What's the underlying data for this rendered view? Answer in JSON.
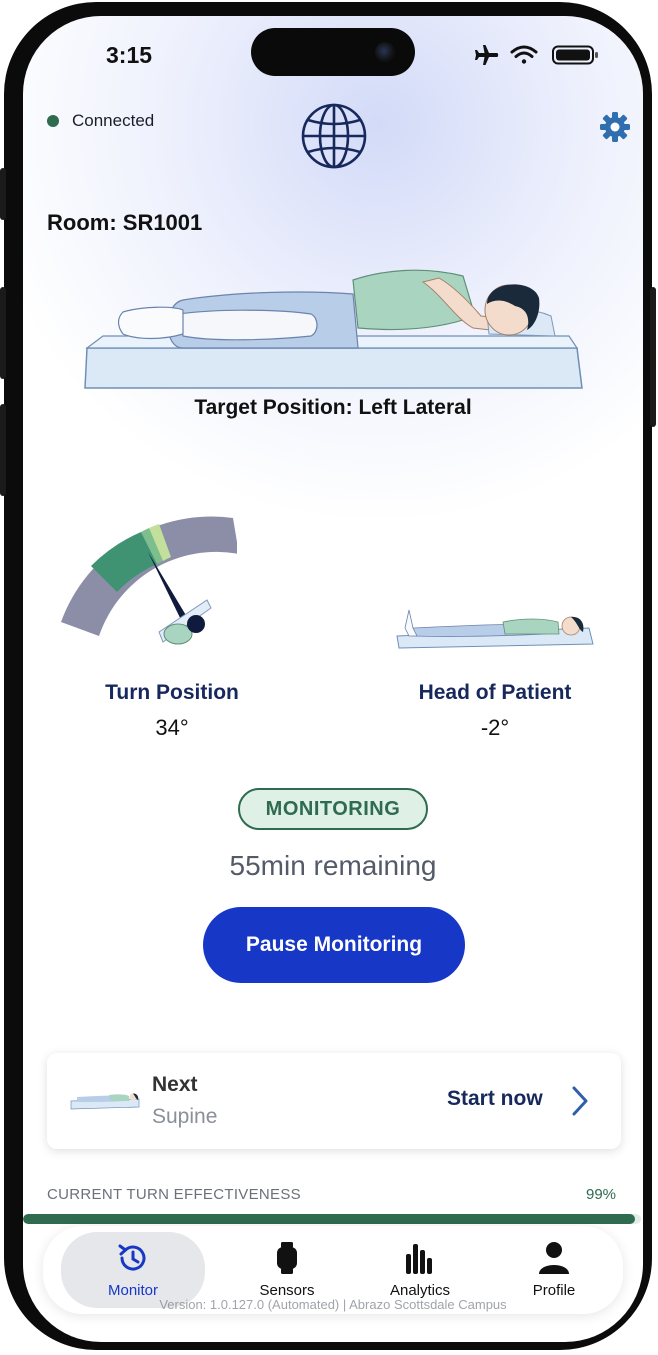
{
  "status_bar": {
    "time": "3:15"
  },
  "header": {
    "connection_status": "Connected",
    "room": "Room: SR1001"
  },
  "target_position": "Target Position: Left Lateral",
  "turn_position": {
    "label": "Turn Position",
    "value": "34°"
  },
  "head_of_patient": {
    "label": "Head of Patient",
    "value": "-2°"
  },
  "monitoring": {
    "badge": "MONITORING",
    "remaining": "55min remaining",
    "pause_label": "Pause Monitoring"
  },
  "next": {
    "title": "Next",
    "position": "Supine",
    "action": "Start now"
  },
  "effectiveness": {
    "label": "CURRENT TURN EFFECTIVENESS",
    "percent_text": "99%",
    "percent": 99
  },
  "tabs": [
    {
      "label": "Monitor",
      "icon": "monitor-history-icon",
      "active": true
    },
    {
      "label": "Sensors",
      "icon": "watch-sensor-icon",
      "active": false
    },
    {
      "label": "Analytics",
      "icon": "bar-chart-icon",
      "active": false
    },
    {
      "label": "Profile",
      "icon": "person-icon",
      "active": false
    }
  ],
  "version": "Version: 1.0.127.0 (Automated) | Abrazo Scottsdale Campus",
  "colors": {
    "accent": "#1737c7",
    "brand_green": "#2e6b4f",
    "navy": "#17285c",
    "gauge_gray": "#8c8ea8"
  }
}
